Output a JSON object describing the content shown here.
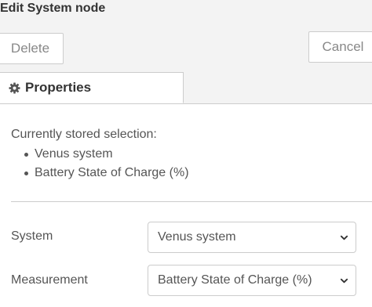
{
  "header": {
    "title": "Edit System node"
  },
  "toolbar": {
    "delete_label": "Delete",
    "cancel_label": "Cancel"
  },
  "tabs": [
    {
      "label": "Properties",
      "icon": "gear-icon",
      "active": true
    }
  ],
  "properties": {
    "stored_label": "Currently stored selection:",
    "stored_items": [
      "Venus system",
      "Battery State of Charge (%)"
    ],
    "system_label": "System",
    "system_value": "Venus system",
    "measurement_label": "Measurement",
    "measurement_value": "Battery State of Charge (%)"
  },
  "colors": {
    "background": "#ffffff",
    "toolbar_bg": "#f3f3f3",
    "border": "#cccccc",
    "text": "#555555"
  }
}
